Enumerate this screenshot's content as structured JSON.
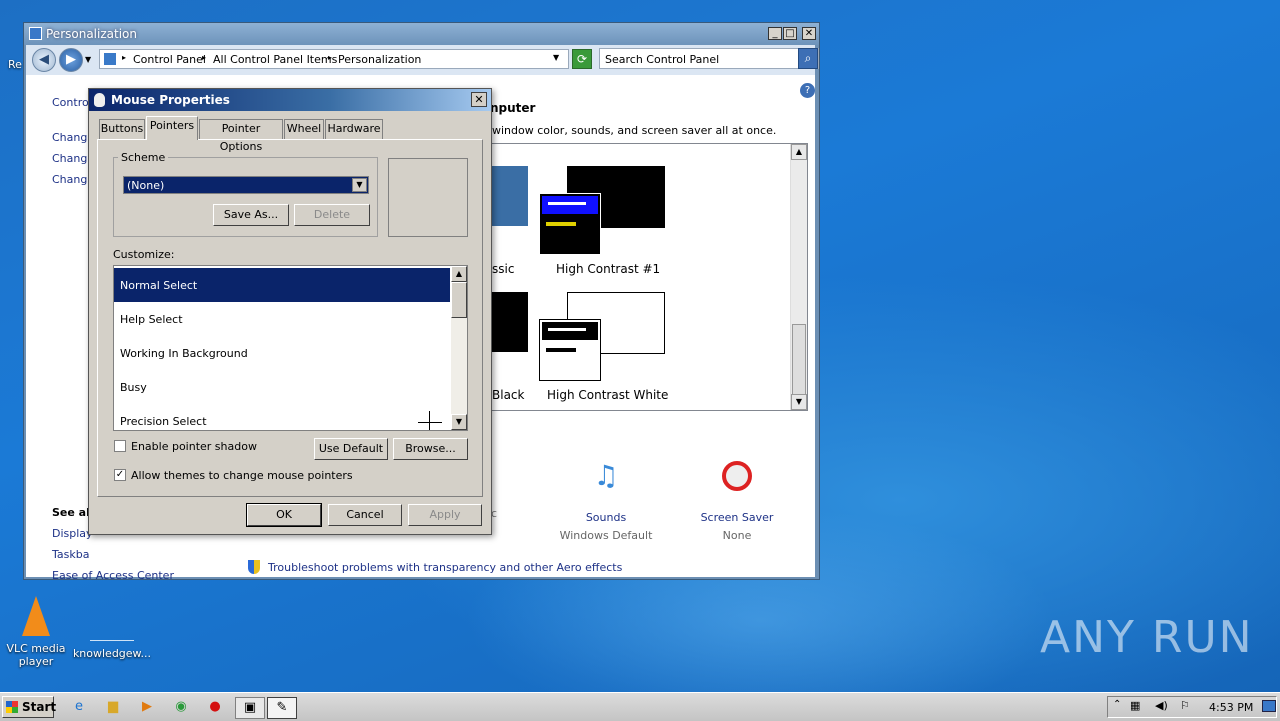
{
  "desktop": {
    "icons": [
      {
        "label": "VLC media player"
      },
      {
        "label": "knowledgew..."
      }
    ],
    "watermark": "ANY RUN",
    "left_fragments": {
      "re": "Re"
    }
  },
  "personalization": {
    "title": "Personalization",
    "title_buttons": {
      "minimize": "_",
      "maximize": "□",
      "close": "✕"
    },
    "breadcrumb": [
      "Control Panel",
      "All Control Panel Items",
      "Personalization"
    ],
    "search_placeholder": "Search Control Panel",
    "left_links": [
      "Control",
      "Change",
      "Change",
      "Change"
    ],
    "heading_fragment": "nputer",
    "description_fragment": "window color, sounds, and screen saver all at once.",
    "themes": [
      {
        "label": "ssic"
      },
      {
        "label": "High Contrast #1"
      },
      {
        "label": "Black"
      },
      {
        "label": "High Contrast White"
      }
    ],
    "see_also_title": "See al",
    "see_also": [
      "Display",
      "Taskba",
      "Ease of Access Center"
    ],
    "settings": [
      {
        "name": "Sounds",
        "value": "Windows Default"
      },
      {
        "name": "Screen Saver",
        "value": "None"
      }
    ],
    "trouble_link": "Troubleshoot problems with transparency and other Aero effects",
    "fragment_c": "c"
  },
  "mouse_properties": {
    "title": "Mouse Properties",
    "close": "✕",
    "tabs": [
      "Buttons",
      "Pointers",
      "Pointer Options",
      "Wheel",
      "Hardware"
    ],
    "active_tab": "Pointers",
    "scheme_label": "Scheme",
    "scheme_value": "(None)",
    "save_as": "Save As...",
    "delete": "Delete",
    "customize_label": "Customize:",
    "cursors": [
      "Normal Select",
      "Help Select",
      "Working In Background",
      "Busy",
      "Precision Select"
    ],
    "selected_cursor": "Normal Select",
    "enable_shadow": "Enable pointer shadow",
    "enable_shadow_checked": false,
    "allow_themes": "Allow themes to change mouse pointers",
    "allow_themes_checked": true,
    "use_default": "Use Default",
    "browse": "Browse...",
    "ok": "OK",
    "cancel": "Cancel",
    "apply": "Apply"
  },
  "taskbar": {
    "start": "Start",
    "clock": "4:53 PM"
  },
  "colors": {
    "selection": "#0a246a",
    "dialog_face": "#d4d0c8",
    "link": "#1e3287"
  }
}
